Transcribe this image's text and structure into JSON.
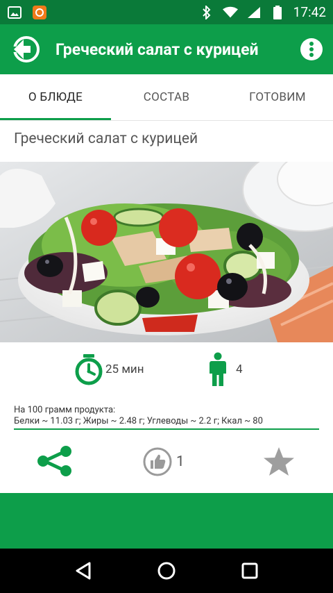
{
  "status_bar": {
    "time": "17:42"
  },
  "app_bar": {
    "title": "Греческий салат с курицей"
  },
  "tabs": [
    {
      "label": "О БЛЮДЕ",
      "active": true
    },
    {
      "label": "СОСТАВ",
      "active": false
    },
    {
      "label": "ГОТОВИМ",
      "active": false
    }
  ],
  "recipe": {
    "title": "Греческий салат с курицей",
    "time": "25 мин",
    "persons": "4",
    "nutrition_heading": "На 100 грамм продукта:",
    "nutrition_values": "Белки ~ 11.03 г; Жиры ~ 2.48 г; Углеводы ~ 2.2 г; Ккал ~ 80"
  },
  "actions": {
    "likes": "1"
  },
  "colors": {
    "primary": "#0d9e4a",
    "primary_dark": "#0a7a39"
  }
}
